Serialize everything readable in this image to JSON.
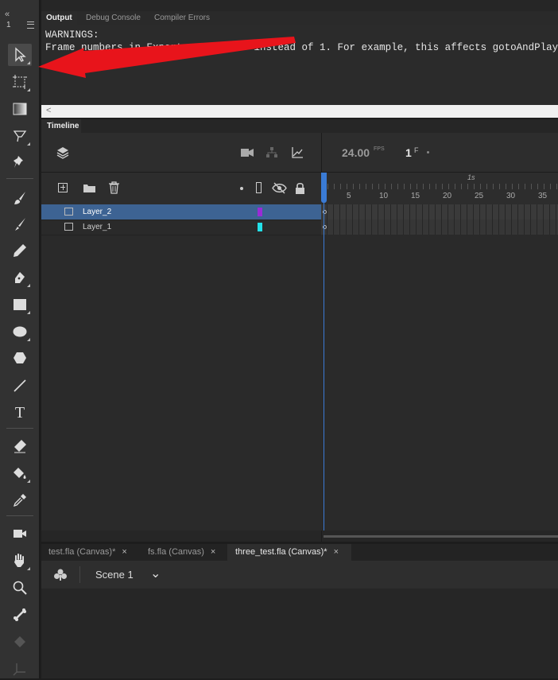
{
  "output_panel": {
    "tabs": [
      "Output",
      "Debug Console",
      "Compiler Errors"
    ],
    "line1": "WARNINGS:",
    "line2": "Frame numbers in Export start at 0 instead of 1. For example, this affects gotoAndPlay",
    "scroll_arrow": "<"
  },
  "timeline": {
    "tab": "Timeline",
    "fps_value": "24.00",
    "fps_unit": "FPS",
    "frame_value": "1",
    "frame_unit": "F",
    "ruler_label": "1s",
    "ruler_numbers": [
      "5",
      "10",
      "15",
      "20",
      "25",
      "30",
      "35"
    ],
    "layers": [
      {
        "name": "Layer_2",
        "color": "#9a2bd6",
        "selected": true
      },
      {
        "name": "Layer_1",
        "color": "#22e0e8",
        "selected": false
      }
    ]
  },
  "toolbar": {
    "collapse": "«",
    "column_label": "1",
    "tools": [
      "selection-arrow-icon",
      "free-transform-icon",
      "gradient-icon",
      "lasso-icon",
      "pin-icon",
      "paint-brush-icon",
      "brush-icon",
      "pencil-icon",
      "pen-icon",
      "rectangle-icon",
      "oval-icon",
      "polygon-icon",
      "line-icon",
      "text-icon",
      "eraser-icon",
      "paint-bucket-icon",
      "eyedropper-icon",
      "camera-icon",
      "hand-icon",
      "zoom-icon",
      "bone-icon",
      "bind-icon",
      "axis-icon"
    ],
    "text_tool_glyph": "T"
  },
  "document_tabs": [
    {
      "label": "test.fla (Canvas)*",
      "active": false
    },
    {
      "label": "fs.fla (Canvas)",
      "active": false
    },
    {
      "label": "three_test.fla (Canvas)*",
      "active": true
    }
  ],
  "close_glyph": "×",
  "scene": {
    "label": "Scene 1",
    "dropdown_glyph": "⌄"
  },
  "accent_colors": {
    "selected_layer": "#3d6393",
    "playhead": "#3a7bd5",
    "annotation_arrow": "#e8141b"
  }
}
